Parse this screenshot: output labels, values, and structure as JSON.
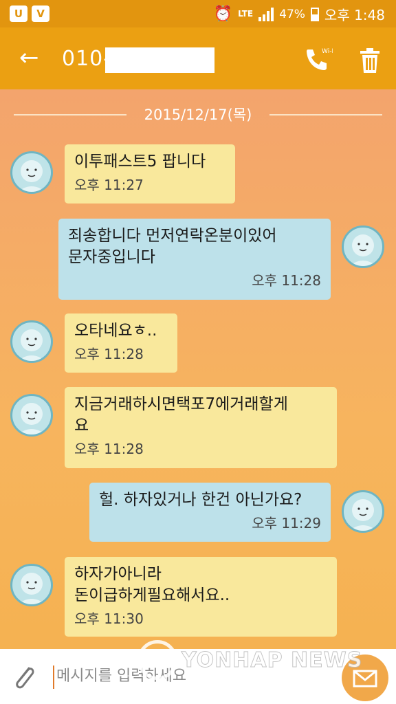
{
  "status": {
    "network": "LTE",
    "battery": "47%",
    "time": "오후 1:48"
  },
  "header": {
    "phone_prefix": "010-"
  },
  "date_separator": "2015/12/17(목)",
  "messages": [
    {
      "dir": "in",
      "text": "이투패스트5  팝니다",
      "time": "오후 11:27"
    },
    {
      "dir": "out",
      "text": "죄송합니다 먼저연락온분이있어\n문자중입니다",
      "time": "오후 11:28"
    },
    {
      "dir": "in",
      "text": "오타네요ㅎ..",
      "time": "오후 11:28"
    },
    {
      "dir": "in",
      "text": "지금거래하시면택포7에거래할게\n요",
      "time": "오후 11:28"
    },
    {
      "dir": "out",
      "text": "헐. 하자있거나 한건 아닌가요?",
      "time": "오후 11:29"
    },
    {
      "dir": "in",
      "text": "하자가아니라\n돈이급하게필요해서요..",
      "time": "오후 11:30"
    }
  ],
  "input": {
    "placeholder": "메시지를 입력하세요"
  },
  "watermark": "YONHAP NEWS",
  "colors": {
    "header": "#eba012",
    "incoming_bubble": "#f9e89c",
    "outgoing_bubble": "#bde1ea"
  }
}
